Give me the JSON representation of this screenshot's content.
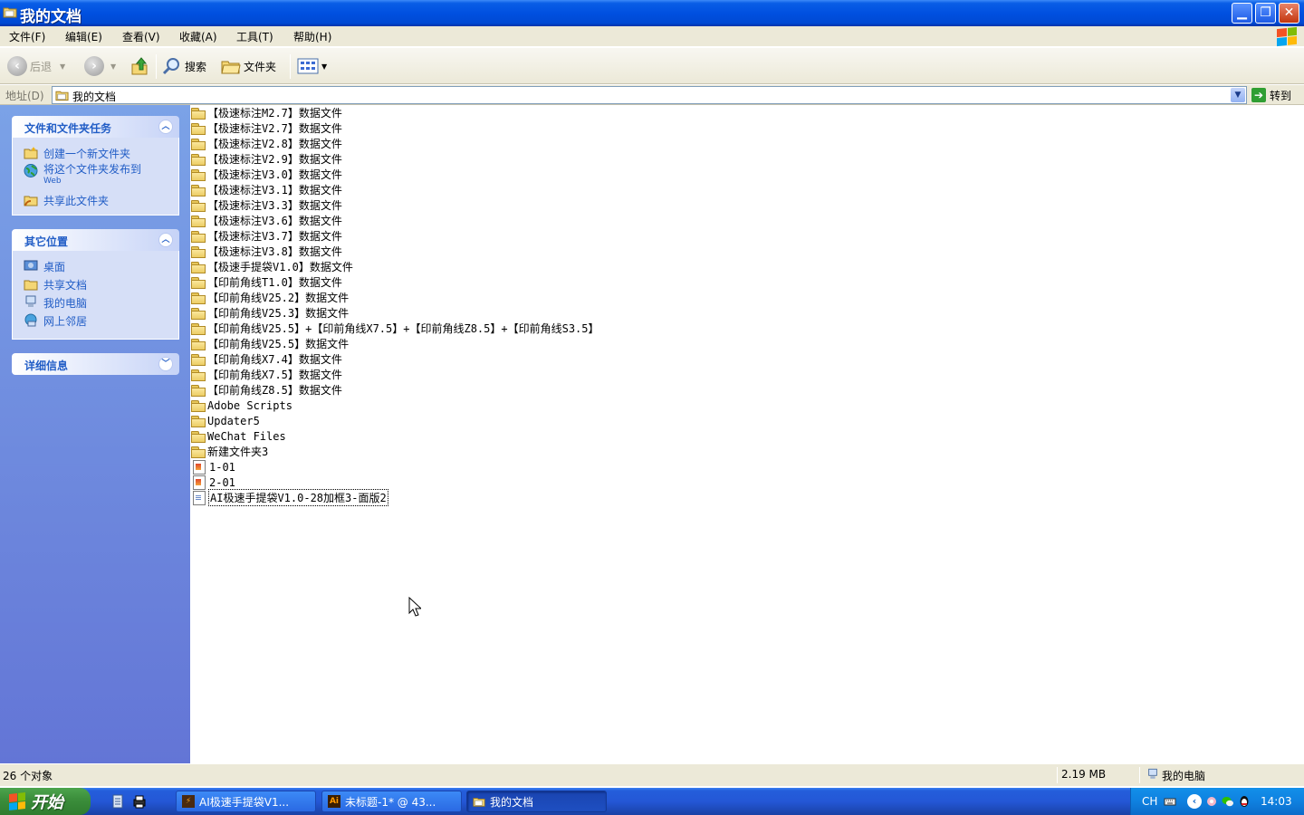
{
  "window": {
    "title": "我的文档"
  },
  "menu": [
    "文件(F)",
    "编辑(E)",
    "查看(V)",
    "收藏(A)",
    "工具(T)",
    "帮助(H)"
  ],
  "toolbar": {
    "back": "后退",
    "search": "搜索",
    "folders": "文件夹"
  },
  "address": {
    "label": "地址(D)",
    "value": "我的文档",
    "go": "转到"
  },
  "left_pane": {
    "file_tasks": {
      "title": "文件和文件夹任务",
      "items": [
        "创建一个新文件夹",
        "将这个文件夹发布到",
        "Web",
        "共享此文件夹"
      ]
    },
    "other_places": {
      "title": "其它位置",
      "items": [
        "桌面",
        "共享文档",
        "我的电脑",
        "网上邻居"
      ]
    },
    "details": {
      "title": "详细信息"
    }
  },
  "files": [
    {
      "name": "【极速标注M2.7】数据文件",
      "type": "folder"
    },
    {
      "name": "【极速标注V2.7】数据文件",
      "type": "folder"
    },
    {
      "name": "【极速标注V2.8】数据文件",
      "type": "folder"
    },
    {
      "name": "【极速标注V2.9】数据文件",
      "type": "folder"
    },
    {
      "name": "【极速标注V3.0】数据文件",
      "type": "folder"
    },
    {
      "name": "【极速标注V3.1】数据文件",
      "type": "folder"
    },
    {
      "name": "【极速标注V3.3】数据文件",
      "type": "folder"
    },
    {
      "name": "【极速标注V3.6】数据文件",
      "type": "folder"
    },
    {
      "name": "【极速标注V3.7】数据文件",
      "type": "folder"
    },
    {
      "name": "【极速标注V3.8】数据文件",
      "type": "folder"
    },
    {
      "name": "【极速手提袋V1.0】数据文件",
      "type": "folder"
    },
    {
      "name": "【印前角线T1.0】数据文件",
      "type": "folder"
    },
    {
      "name": "【印前角线V25.2】数据文件",
      "type": "folder"
    },
    {
      "name": "【印前角线V25.3】数据文件",
      "type": "folder"
    },
    {
      "name": "【印前角线V25.5】+【印前角线X7.5】+【印前角线Z8.5】+【印前角线S3.5】",
      "type": "folder"
    },
    {
      "name": "【印前角线V25.5】数据文件",
      "type": "folder"
    },
    {
      "name": "【印前角线X7.4】数据文件",
      "type": "folder"
    },
    {
      "name": "【印前角线X7.5】数据文件",
      "type": "folder"
    },
    {
      "name": "【印前角线Z8.5】数据文件",
      "type": "folder"
    },
    {
      "name": "Adobe Scripts",
      "type": "folder"
    },
    {
      "name": "Updater5",
      "type": "folder"
    },
    {
      "name": "WeChat Files",
      "type": "folder"
    },
    {
      "name": "新建文件夹3",
      "type": "folder"
    },
    {
      "name": "1-01",
      "type": "image"
    },
    {
      "name": "2-01",
      "type": "image"
    },
    {
      "name": "AI极速手提袋V1.0-28加框3-面版2",
      "type": "text",
      "selected": true
    }
  ],
  "status": {
    "count": "26 个对象",
    "size": "2.19 MB",
    "location": "我的电脑"
  },
  "taskbar": {
    "start": "开始",
    "buttons": [
      "AI极速手提袋V1...",
      "未标题-1* @ 43...",
      "我的文档"
    ],
    "lang": "CH",
    "clock": "14:03"
  }
}
